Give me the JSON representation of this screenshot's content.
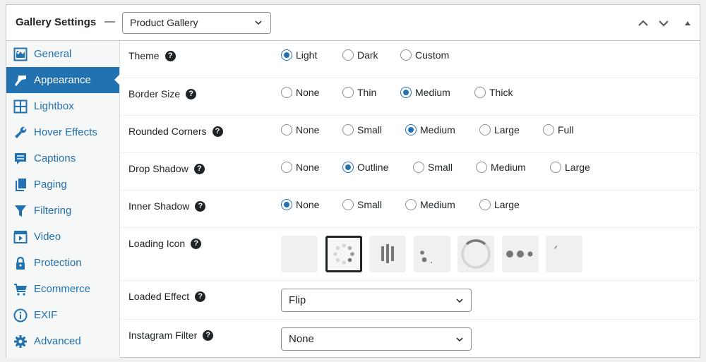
{
  "header": {
    "title": "Gallery Settings",
    "separator": "—",
    "gallery_select": {
      "value": "Product Gallery"
    },
    "buttons": [
      "move-up",
      "move-down",
      "toggle-panel"
    ]
  },
  "sidebar": {
    "items": [
      {
        "label": "General",
        "icon": "image-icon",
        "active": false
      },
      {
        "label": "Appearance",
        "icon": "paintbrush-icon",
        "active": true
      },
      {
        "label": "Lightbox",
        "icon": "grid-icon",
        "active": false
      },
      {
        "label": "Hover Effects",
        "icon": "wrench-icon",
        "active": false
      },
      {
        "label": "Captions",
        "icon": "comment-icon",
        "active": false
      },
      {
        "label": "Paging",
        "icon": "pages-icon",
        "active": false
      },
      {
        "label": "Filtering",
        "icon": "filter-icon",
        "active": false
      },
      {
        "label": "Video",
        "icon": "video-icon",
        "active": false
      },
      {
        "label": "Protection",
        "icon": "lock-icon",
        "active": false
      },
      {
        "label": "Ecommerce",
        "icon": "cart-icon",
        "active": false
      },
      {
        "label": "EXIF",
        "icon": "info-icon",
        "active": false
      },
      {
        "label": "Advanced",
        "icon": "gear-icon",
        "active": false
      }
    ]
  },
  "settings": {
    "theme": {
      "label": "Theme",
      "help": "?",
      "options": [
        "Light",
        "Dark",
        "Custom"
      ],
      "selected": "Light"
    },
    "border_size": {
      "label": "Border Size",
      "help": "?",
      "options": [
        "None",
        "Thin",
        "Medium",
        "Thick"
      ],
      "selected": "Medium"
    },
    "rounded_corners": {
      "label": "Rounded Corners",
      "help": "?",
      "options": [
        "None",
        "Small",
        "Medium",
        "Large",
        "Full"
      ],
      "selected": "Medium"
    },
    "drop_shadow": {
      "label": "Drop Shadow",
      "help": "?",
      "options": [
        "None",
        "Outline",
        "Small",
        "Medium",
        "Large"
      ],
      "selected": "Outline"
    },
    "inner_shadow": {
      "label": "Inner Shadow",
      "help": "?",
      "options": [
        "None",
        "Small",
        "Medium",
        "Large"
      ],
      "selected": "None"
    },
    "loading_icon": {
      "label": "Loading Icon",
      "help": "?",
      "options": [
        "none",
        "dots-spinner",
        "bars",
        "bouncing-dots",
        "ring",
        "three-dots",
        "trail"
      ],
      "selected": "dots-spinner"
    },
    "loaded_effect": {
      "label": "Loaded Effect",
      "help": "?",
      "value": "Flip"
    },
    "instagram_filter": {
      "label": "Instagram Filter",
      "help": "?",
      "value": "None"
    }
  },
  "colors": {
    "accent": "#2271b1",
    "text": "#1d2327",
    "sidebar_bg": "#f6f7f7"
  }
}
